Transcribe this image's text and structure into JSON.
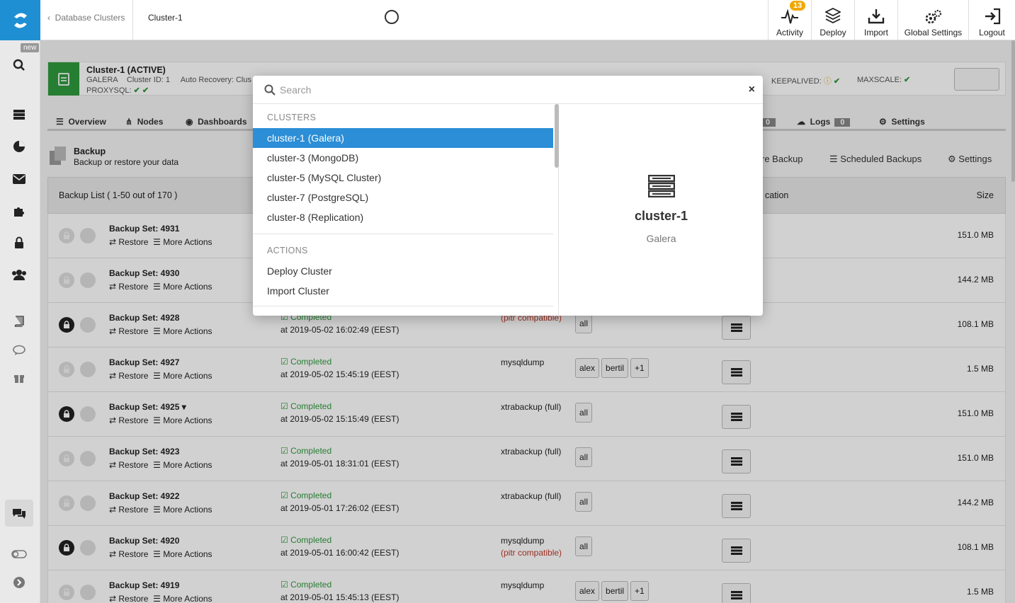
{
  "topbar": {
    "breadcrumb": "Database Clusters",
    "current": "Cluster-1",
    "buttons": [
      {
        "label": "Activity",
        "badge": "13",
        "icon": "activity-icon"
      },
      {
        "label": "Deploy",
        "icon": "deploy-icon"
      },
      {
        "label": "Import",
        "icon": "import-icon"
      },
      {
        "label": "Global Settings",
        "icon": "gears-icon"
      },
      {
        "label": "Logout",
        "icon": "logout-icon"
      }
    ]
  },
  "rail": {
    "new_badge": "new"
  },
  "cluster": {
    "name": "Cluster-1 (ACTIVE)",
    "meta_type": "GALERA",
    "meta_id": "Cluster ID: 1",
    "meta_recovery": "Auto Recovery: Clus",
    "proxysql": "PROXYSQL:",
    "keepalived": "KEEPALIVED:",
    "maxscale": "MAXSCALE:"
  },
  "tabs": {
    "overview": "Overview",
    "nodes": "Nodes",
    "dashboards": "Dashboards",
    "logs": "Logs",
    "logs_count": "0",
    "hidden_count": "0",
    "settings": "Settings"
  },
  "backup": {
    "title": "Backup",
    "subtitle": "Backup or restore your data",
    "restore_link": "re Backup",
    "scheduled_link": "Scheduled Backups",
    "settings_link": "Settings"
  },
  "list": {
    "header": "Backup List ( 1-50 out of 170 )",
    "col_location": "cation",
    "col_size": "Size",
    "restore_label": "Restore",
    "more_label": "More Actions",
    "rows": [
      {
        "name": "Backup Set: 4931",
        "status": "",
        "when": "",
        "method": "",
        "pitr": "",
        "dbs": [],
        "size": "151.0 MB",
        "locked": false
      },
      {
        "name": "Backup Set: 4930",
        "status": "",
        "when": "",
        "method": "",
        "pitr": "",
        "dbs": [],
        "size": "144.2 MB",
        "locked": false
      },
      {
        "name": "Backup Set: 4928",
        "status": "Completed",
        "when": "at 2019-05-02 16:02:49 (EEST)",
        "method": "",
        "pitr": "(pitr compatible)",
        "dbs": [
          "all"
        ],
        "size": "108.1 MB",
        "locked": true
      },
      {
        "name": "Backup Set: 4927",
        "status": "Completed",
        "when": "at 2019-05-02 15:45:19 (EEST)",
        "method": "mysqldump",
        "pitr": "",
        "dbs": [
          "alex",
          "bertil",
          "+1"
        ],
        "size": "1.5 MB",
        "locked": false
      },
      {
        "name": "Backup Set: 4925 ▾",
        "status": "Completed",
        "when": "at 2019-05-02 15:15:49 (EEST)",
        "method": "xtrabackup (full)",
        "pitr": "",
        "dbs": [
          "all"
        ],
        "size": "151.0 MB",
        "locked": true
      },
      {
        "name": "Backup Set: 4923",
        "status": "Completed",
        "when": "at 2019-05-01 18:31:01 (EEST)",
        "method": "xtrabackup (full)",
        "pitr": "",
        "dbs": [
          "all"
        ],
        "size": "151.0 MB",
        "locked": false
      },
      {
        "name": "Backup Set: 4922",
        "status": "Completed",
        "when": "at 2019-05-01 17:26:02 (EEST)",
        "method": "xtrabackup (full)",
        "pitr": "",
        "dbs": [
          "all"
        ],
        "size": "144.2 MB",
        "locked": false
      },
      {
        "name": "Backup Set: 4920",
        "status": "Completed",
        "when": "at 2019-05-01 16:00:42 (EEST)",
        "method": "mysqldump",
        "pitr": "(pitr compatible)",
        "dbs": [
          "all"
        ],
        "size": "108.1 MB",
        "locked": true
      },
      {
        "name": "Backup Set: 4919",
        "status": "Completed",
        "when": "at 2019-05-01 15:45:13 (EEST)",
        "method": "mysqldump",
        "pitr": "",
        "dbs": [
          "alex",
          "bertil",
          "+1"
        ],
        "size": "1.5 MB",
        "locked": false
      }
    ]
  },
  "modal": {
    "search_placeholder": "Search",
    "section_clusters": "CLUSTERS",
    "section_actions": "ACTIONS",
    "clusters": [
      "cluster-1 (Galera)",
      "cluster-3 (MongoDB)",
      "cluster-5 (MySQL Cluster)",
      "cluster-7 (PostgreSQL)",
      "cluster-8 (Replication)"
    ],
    "actions": [
      "Deploy Cluster",
      "Import Cluster"
    ],
    "preview_name": "cluster-1",
    "preview_type": "Galera"
  },
  "colors": {
    "accent": "#2b8ed6",
    "success": "#2f9a3e",
    "warning": "#f0a800",
    "danger": "#c0392b"
  }
}
